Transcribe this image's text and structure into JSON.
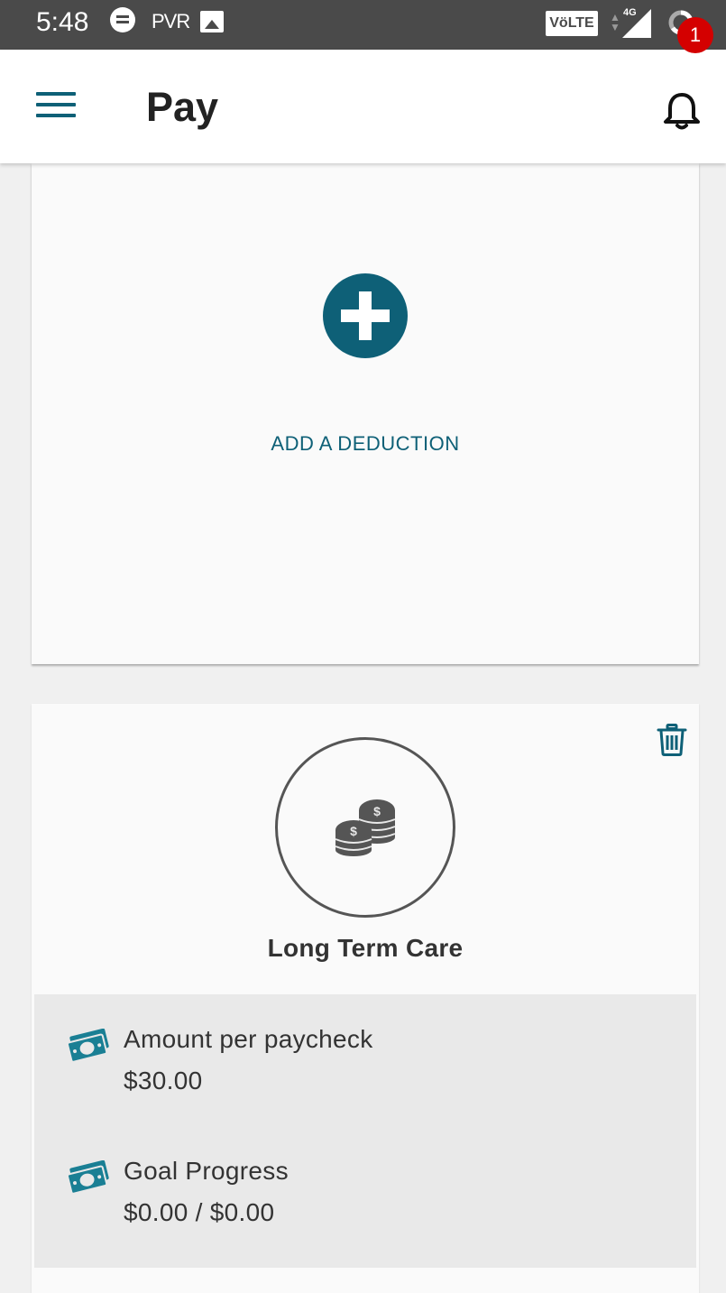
{
  "status_bar": {
    "time": "5:48",
    "carrier_label": "PVR",
    "volte_label": "VöLTE",
    "network_label": "4G"
  },
  "app_bar": {
    "title": "Pay",
    "notification_count": "1",
    "accent_color": "#0e6077"
  },
  "add_card": {
    "label": "ADD A DEDUCTION"
  },
  "deduction": {
    "name": "Long Term Care",
    "details": [
      {
        "label": "Amount per paycheck",
        "value": "$30.00"
      },
      {
        "label": "Goal Progress",
        "value": "$0.00 / $0.00"
      }
    ]
  },
  "icons": [
    "menu-icon",
    "bell-icon",
    "plus-icon",
    "trash-icon",
    "coins-icon",
    "money-icon"
  ]
}
